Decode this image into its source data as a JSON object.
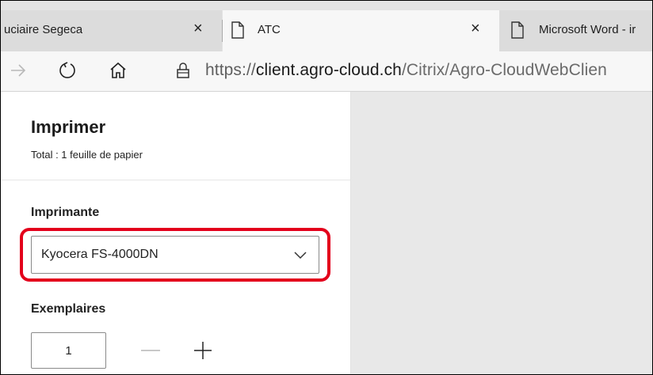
{
  "tabs": [
    {
      "title": "uciaire Segeca",
      "close": "×",
      "active": false,
      "icon": "none"
    },
    {
      "title": "ATC",
      "close": "×",
      "active": true,
      "icon": "page-icon"
    },
    {
      "title": "Microsoft Word - ir",
      "close": "",
      "active": false,
      "icon": "page-icon"
    }
  ],
  "nav": {
    "back_icon": "arrow-right-icon",
    "refresh_icon": "refresh-icon",
    "home_icon": "home-icon",
    "lock_icon": "lock-icon"
  },
  "url": {
    "proto": "https://",
    "domain": "client.agro-cloud.ch",
    "path": "/Citrix/Agro-CloudWebClien"
  },
  "print": {
    "title": "Imprimer",
    "total": "Total : 1 feuille de papier",
    "printer_label": "Imprimante",
    "printer_value": "Kyocera FS-4000DN",
    "copies_label": "Exemplaires",
    "copies_value": "1"
  },
  "colors": {
    "highlight": "#e3001b",
    "tabstrip": "#e3e3e3",
    "active_tab": "#f7f7f7",
    "preview_bg": "#e8e8e8"
  }
}
